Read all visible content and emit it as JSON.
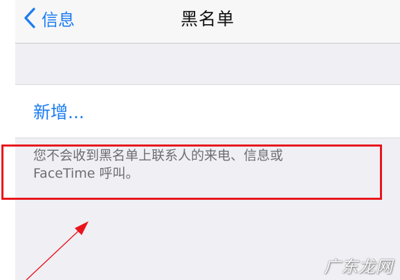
{
  "navbar": {
    "back_label": "信息",
    "title": "黑名单"
  },
  "cell": {
    "add_label": "新增..."
  },
  "footer": {
    "line1": "您不会收到黑名单上联系人的来电、信息或",
    "line2": "FaceTime 呼叫。"
  },
  "watermark": {
    "text": "广东龙网"
  },
  "colors": {
    "accent": "#1b7cf2",
    "highlight": "#e8141b"
  }
}
